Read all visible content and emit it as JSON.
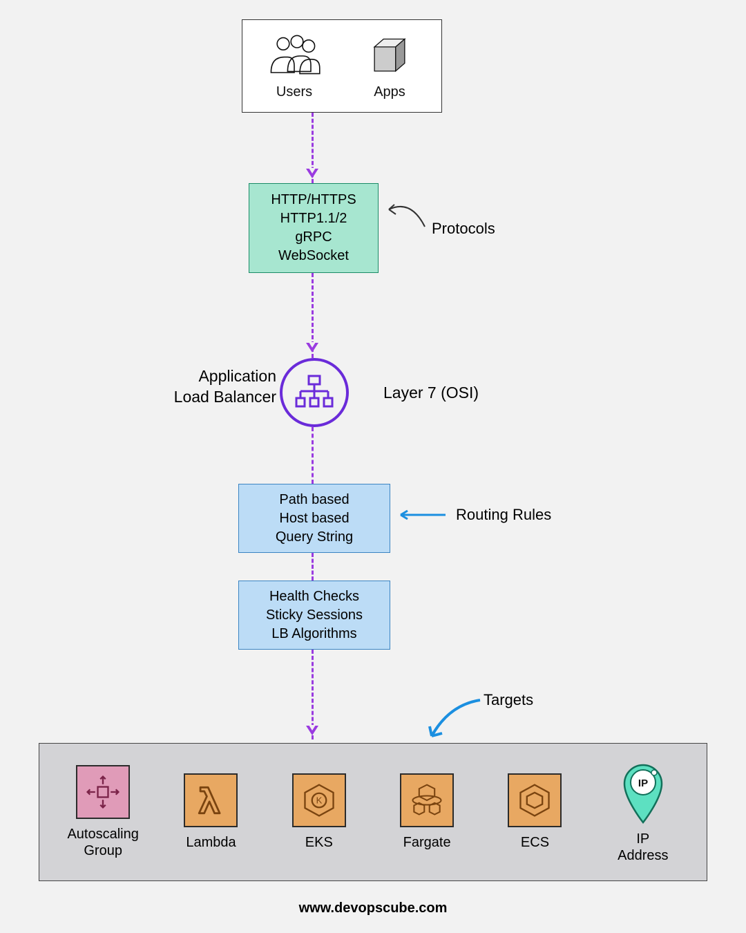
{
  "top": {
    "users_label": "Users",
    "apps_label": "Apps"
  },
  "protocols": {
    "lines": [
      "HTTP/HTTPS",
      "HTTP1.1/2",
      "gRPC",
      "WebSocket"
    ],
    "side_label": "Protocols"
  },
  "alb": {
    "left_label": "Application\nLoad Balancer",
    "right_label": "Layer 7 (OSI)"
  },
  "routing": {
    "lines": [
      "Path based",
      "Host based",
      "Query String"
    ],
    "side_label": "Routing Rules"
  },
  "health": {
    "lines": [
      "Health Checks",
      "Sticky Sessions",
      "LB Algorithms"
    ]
  },
  "targets": {
    "side_label": "Targets",
    "items": [
      {
        "label": "Autoscaling\nGroup"
      },
      {
        "label": "Lambda"
      },
      {
        "label": "EKS"
      },
      {
        "label": "Fargate"
      },
      {
        "label": "ECS"
      },
      {
        "label": "IP\nAddress"
      }
    ]
  },
  "footer": "www.devopscube.com"
}
